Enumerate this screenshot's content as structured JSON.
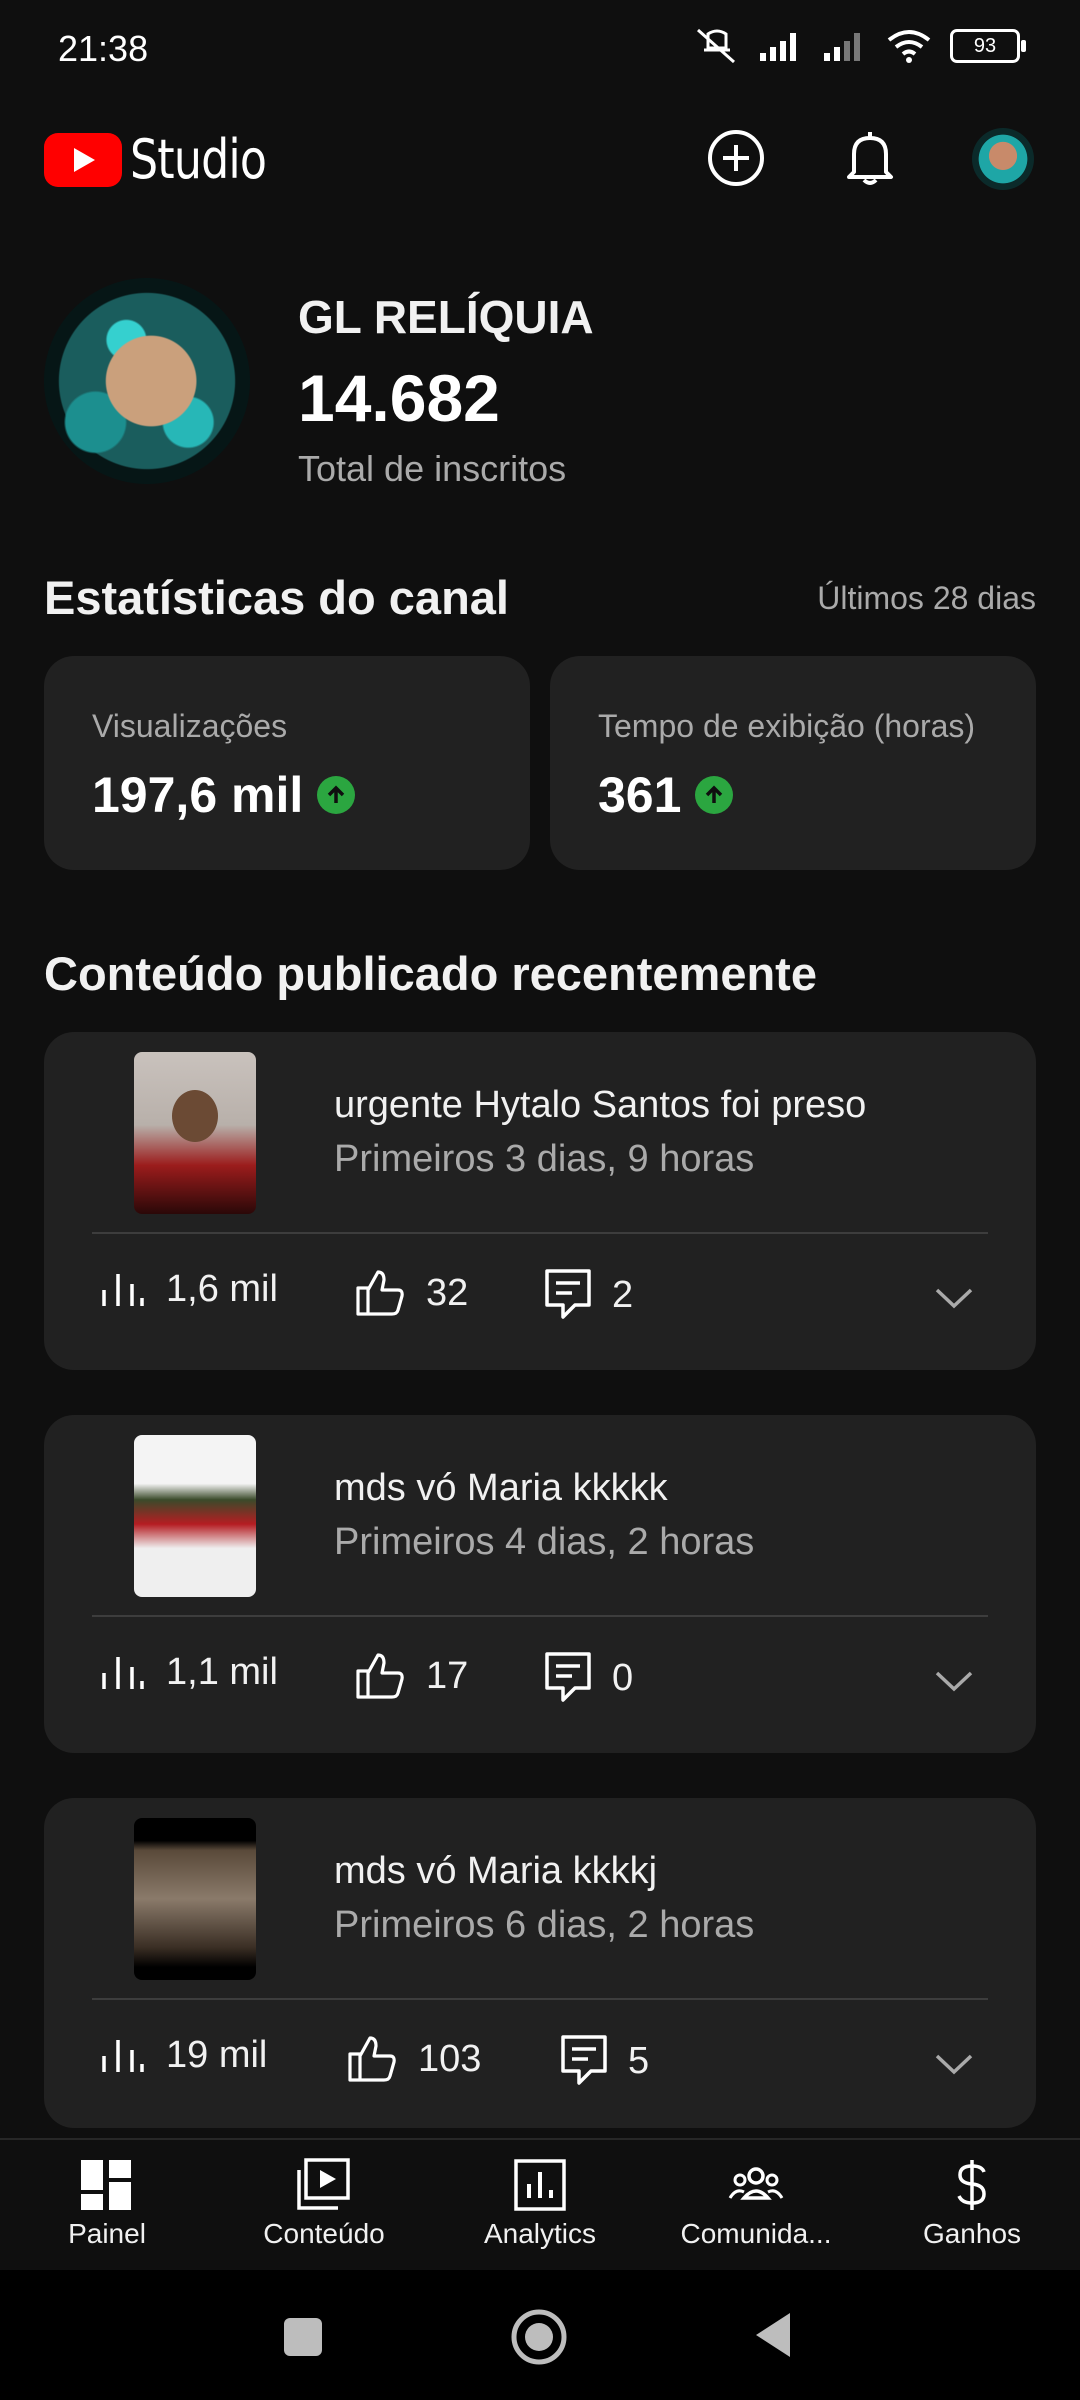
{
  "status_bar": {
    "time": "21:38",
    "battery": "93"
  },
  "header": {
    "logo_text": "Studio"
  },
  "channel": {
    "name": "GL RELÍQUIA",
    "subscribers": "14.682",
    "subscribers_label": "Total de inscritos"
  },
  "stats": {
    "title": "Estatísticas do canal",
    "period": "Últimos 28 dias",
    "cards": [
      {
        "label": "Visualizações",
        "value": "197,6 mil"
      },
      {
        "label": "Tempo de exibição (horas)",
        "value": "361"
      }
    ]
  },
  "recent": {
    "title": "Conteúdo publicado recentemente",
    "videos": [
      {
        "title": "urgente Hytalo Santos foi preso",
        "subtitle": "Primeiros 3 dias, 9 horas",
        "views": "1,6 mil",
        "likes": "32",
        "comments": "2"
      },
      {
        "title": "mds vó Maria kkkkk",
        "subtitle": "Primeiros 4 dias, 2 horas",
        "views": "1,1 mil",
        "likes": "17",
        "comments": "0"
      },
      {
        "title": "mds vó Maria kkkkj",
        "subtitle": "Primeiros 6 dias, 2 horas",
        "views": "19 mil",
        "likes": "103",
        "comments": "5"
      }
    ]
  },
  "bottom_nav": {
    "items": [
      {
        "label": "Painel",
        "icon": "dashboard-icon"
      },
      {
        "label": "Conteúdo",
        "icon": "content-icon"
      },
      {
        "label": "Analytics",
        "icon": "analytics-icon"
      },
      {
        "label": "Comunida...",
        "icon": "community-icon"
      },
      {
        "label": "Ganhos",
        "icon": "earn-icon"
      }
    ]
  },
  "colors": {
    "background": "#0f0f0f",
    "card": "#212121",
    "accent_red": "#ff0000",
    "trend_green": "#2ba640",
    "secondary_text": "#aaaaaa"
  }
}
